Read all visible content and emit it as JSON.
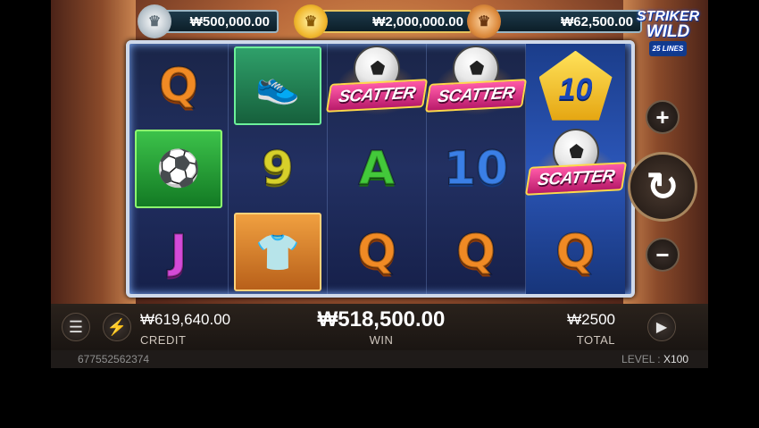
{
  "jackpots": {
    "silver": {
      "icon": "silver-medal-icon",
      "amount": "₩500,000.00"
    },
    "gold": {
      "icon": "gold-medal-icon",
      "amount": "₩2,000,000.00"
    },
    "bronze": {
      "icon": "bronze-medal-icon",
      "amount": "₩62,500.00"
    }
  },
  "logo": {
    "line1": "STRIKER",
    "line2": "WILD",
    "line3": "25 LINES"
  },
  "reels": [
    [
      {
        "type": "letter",
        "value": "Q"
      },
      {
        "type": "picture",
        "icon": "goal-net-icon"
      },
      {
        "type": "letter",
        "value": "J"
      }
    ],
    [
      {
        "type": "picture",
        "icon": "football-boot-icon"
      },
      {
        "type": "letter",
        "value": "9"
      },
      {
        "type": "picture",
        "icon": "jersey-icon"
      }
    ],
    [
      {
        "type": "scatter",
        "value": "SCATTER"
      },
      {
        "type": "letter",
        "value": "A"
      },
      {
        "type": "letter",
        "value": "Q"
      }
    ],
    [
      {
        "type": "scatter",
        "value": "SCATTER"
      },
      {
        "type": "letter",
        "value": "10"
      },
      {
        "type": "letter",
        "value": "Q"
      }
    ],
    [
      {
        "type": "badge",
        "value": "10"
      },
      {
        "type": "scatter",
        "value": "SCATTER"
      },
      {
        "type": "letter",
        "value": "Q"
      }
    ]
  ],
  "controls": {
    "plus": "+",
    "minus": "−",
    "spin": "↻",
    "menu": "☰",
    "turbo": "⚡",
    "auto": "▶"
  },
  "bottom": {
    "credit_value": "₩619,640.00",
    "credit_label": "CREDIT",
    "win_value": "₩518,500.00",
    "win_label": "WIN",
    "total_value": "₩2500",
    "total_label": "TOTAL"
  },
  "footer": {
    "game_id": "677552562374",
    "level_label": "LEVEL",
    "level_value": "X100"
  },
  "colors": {
    "gold": "#f1b930",
    "reel_frame": "#cfd9ea",
    "scatter": "#e0358a"
  }
}
